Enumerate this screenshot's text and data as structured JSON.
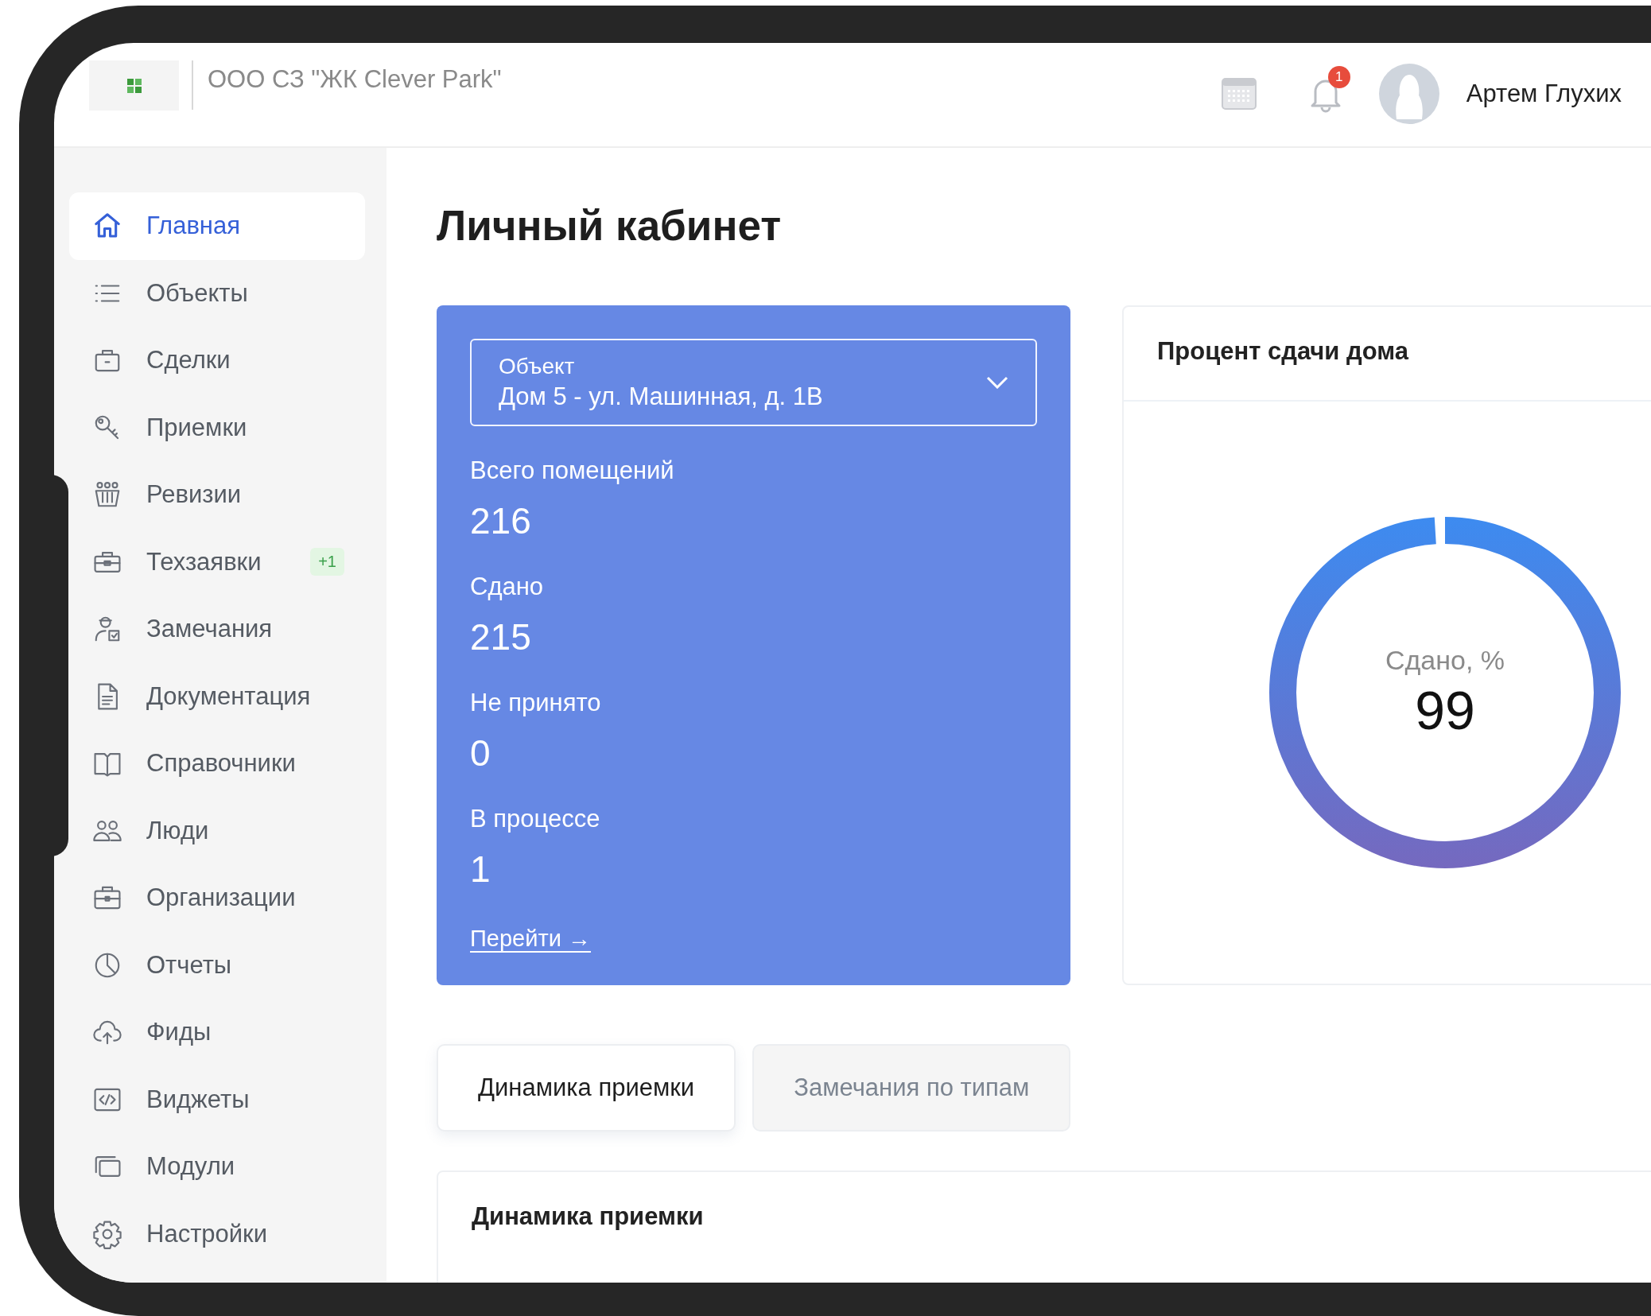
{
  "header": {
    "company": "ООО СЗ \"ЖК Clever Park\"",
    "notifications": "1",
    "user": "Артем Глухих"
  },
  "sidebar": {
    "items": [
      {
        "label": "Главная",
        "selected": true
      },
      {
        "label": "Объекты",
        "selected": false
      },
      {
        "label": "Сделки",
        "selected": false
      },
      {
        "label": "Приемки",
        "selected": false
      },
      {
        "label": "Ревизии",
        "selected": false
      },
      {
        "label": "Техзаявки",
        "selected": false,
        "badge": "+1"
      },
      {
        "label": "Замечания",
        "selected": false
      },
      {
        "label": "Документация",
        "selected": false
      },
      {
        "label": "Справочники",
        "selected": false
      },
      {
        "label": "Люди",
        "selected": false
      },
      {
        "label": "Организации",
        "selected": false
      },
      {
        "label": "Отчеты",
        "selected": false
      },
      {
        "label": "Фиды",
        "selected": false
      },
      {
        "label": "Виджеты",
        "selected": false
      },
      {
        "label": "Модули",
        "selected": false
      },
      {
        "label": "Настройки",
        "selected": false
      }
    ]
  },
  "page_title": "Личный кабинет",
  "object_card": {
    "select": {
      "label": "Объект",
      "value": "Дом 5 - ул. Машинная, д. 1В"
    },
    "stats": [
      {
        "label": "Всего помещений",
        "value": "216"
      },
      {
        "label": "Сдано",
        "value": "215"
      },
      {
        "label": "Не принято",
        "value": "0"
      },
      {
        "label": "В процессе",
        "value": "1"
      }
    ],
    "link": "Перейти →"
  },
  "progress_card": {
    "title": "Процент сдачи дома",
    "caption": "Сдано, %",
    "value": "99",
    "level": 0.99
  },
  "tabs": [
    {
      "label": "Динамика приемки",
      "selected": true
    },
    {
      "label": "Замечания по типам",
      "selected": false
    }
  ],
  "chart_card": {
    "title": "Динамика приемки"
  }
}
